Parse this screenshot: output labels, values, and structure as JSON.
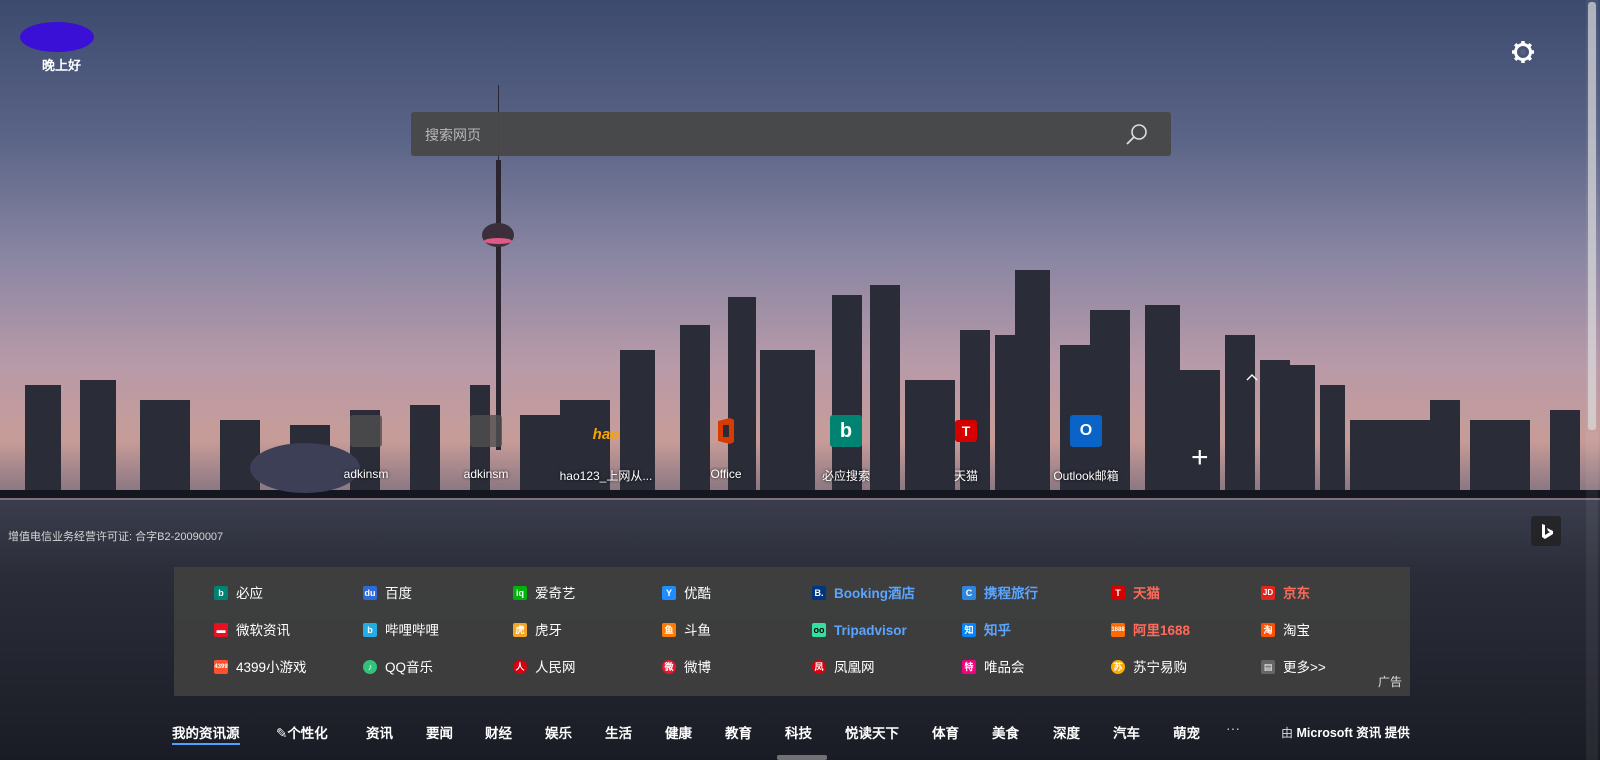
{
  "header": {
    "greeting": "晚上好",
    "settings_icon": "gear-icon"
  },
  "search": {
    "placeholder": "搜索网页",
    "icon": "search-icon"
  },
  "top_sites": [
    {
      "label": "adkinsm",
      "icon": "site-icon",
      "color": "#555555"
    },
    {
      "label": "adkinsm",
      "icon": "site-icon",
      "color": "#555555"
    },
    {
      "label": "hao123_上网从...",
      "icon": "hao123-icon",
      "color": "#44a53a"
    },
    {
      "label": "Office",
      "icon": "office-icon",
      "color": "#d83b01"
    },
    {
      "label": "必应搜索",
      "icon": "bing-icon",
      "color": "#008373"
    },
    {
      "label": "天猫",
      "icon": "tmall-icon",
      "color": "#d50000"
    },
    {
      "label": "Outlook邮箱",
      "icon": "outlook-icon",
      "color": "#0a64c8"
    }
  ],
  "license_text": "增值电信业务经营许可证: 合字B2-20090007",
  "quick_links": {
    "rows": [
      [
        {
          "label": "必应",
          "color": "#ffffff",
          "icon_color": "#008373",
          "icon_text": "b"
        },
        {
          "label": "百度",
          "color": "#ffffff",
          "icon_color": "#2e6bd9",
          "icon_text": "du"
        },
        {
          "label": "爱奇艺",
          "color": "#ffffff",
          "icon_color": "#00b30c",
          "icon_text": "iq"
        },
        {
          "label": "优酷",
          "color": "#ffffff",
          "icon_color": "#1f8cff",
          "icon_text": "Y"
        },
        {
          "label": "Booking酒店",
          "color": "#5aa5ff",
          "icon_color": "#003580",
          "icon_text": "B."
        },
        {
          "label": "携程旅行",
          "color": "#5aa5ff",
          "icon_color": "#2e86de",
          "icon_text": "C"
        },
        {
          "label": "天猫",
          "color": "#ff6b5a",
          "icon_color": "#d50000",
          "icon_text": "T"
        },
        {
          "label": "京东",
          "color": "#ff6b5a",
          "icon_color": "#e1251b",
          "icon_text": "JD"
        }
      ],
      [
        {
          "label": "微软资讯",
          "color": "#ffffff",
          "icon_color": "#e81123",
          "icon_text": "▬"
        },
        {
          "label": "哔哩哔哩",
          "color": "#ffffff",
          "icon_color": "#23ade5",
          "icon_text": "b"
        },
        {
          "label": "虎牙",
          "color": "#ffffff",
          "icon_color": "#f5a623",
          "icon_text": "虎"
        },
        {
          "label": "斗鱼",
          "color": "#ffffff",
          "icon_color": "#ff7a00",
          "icon_text": "鱼"
        },
        {
          "label": "Tripadvisor",
          "color": "#5aa5ff",
          "icon_color": "#34e0a1",
          "icon_text": "oo"
        },
        {
          "label": "知乎",
          "color": "#5aa5ff",
          "icon_color": "#0084ff",
          "icon_text": "知"
        },
        {
          "label": "阿里1688",
          "color": "#ff6b5a",
          "icon_color": "#ff6a00",
          "icon_text": "1688"
        },
        {
          "label": "淘宝",
          "color": "#ffffff",
          "icon_color": "#ff5000",
          "icon_text": "淘"
        }
      ],
      [
        {
          "label": "4399小游戏",
          "color": "#ffffff",
          "icon_color": "#ff4f2c",
          "icon_text": "4399"
        },
        {
          "label": "QQ音乐",
          "color": "#ffffff",
          "icon_color": "#31c27c",
          "icon_text": "♪"
        },
        {
          "label": "人民网",
          "color": "#ffffff",
          "icon_color": "#d7000f",
          "icon_text": "人"
        },
        {
          "label": "微博",
          "color": "#ffffff",
          "icon_color": "#e6162d",
          "icon_text": "微"
        },
        {
          "label": "凤凰网",
          "color": "#ffffff",
          "icon_color": "#d7000f",
          "icon_text": "凤"
        },
        {
          "label": "唯品会",
          "color": "#ffffff",
          "icon_color": "#f10180",
          "icon_text": "特"
        },
        {
          "label": "苏宁易购",
          "color": "#ffffff",
          "icon_color": "#ffaa00",
          "icon_text": "苏"
        },
        {
          "label": "更多>>",
          "color": "#ffffff",
          "icon_color": "#666666",
          "icon_text": "▤"
        }
      ]
    ],
    "ad_label": "广告"
  },
  "news_nav": {
    "tabs": [
      "我的资讯源",
      "个性化",
      "资讯",
      "要闻",
      "财经",
      "娱乐",
      "生活",
      "健康",
      "教育",
      "科技",
      "悦读天下",
      "体育",
      "美食",
      "深度",
      "汽车",
      "萌宠"
    ],
    "active_tab": "我的资讯源",
    "more": "···",
    "provider_prefix": "由",
    "provider_name": "Microsoft 资讯",
    "provider_suffix": "提供"
  }
}
